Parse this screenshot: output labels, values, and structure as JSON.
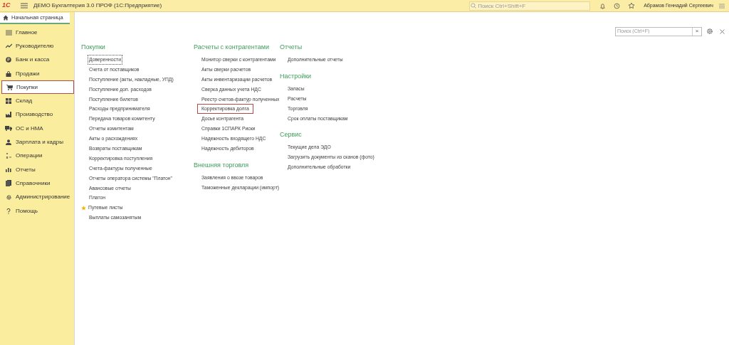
{
  "window": {
    "title": "ДЕМО Бухгалтерия 3.0 ПРОФ  (1С:Предприятие)",
    "logo": "1С",
    "search_placeholder": "Поиск Ctrl+Shift+F",
    "user": "Абрамов Геннадий Сергеевич"
  },
  "tabs": [
    {
      "label": "Начальная страница",
      "selected": true
    }
  ],
  "sidebar": {
    "items": [
      {
        "label": "Главное",
        "selected": false
      },
      {
        "label": "Руководителю",
        "selected": false
      },
      {
        "label": "Банк и касса",
        "selected": false
      },
      {
        "label": "Продажи",
        "selected": false
      },
      {
        "label": "Покупки",
        "selected": true
      },
      {
        "label": "Склад",
        "selected": false
      },
      {
        "label": "Производство",
        "selected": false
      },
      {
        "label": "ОС и НМА",
        "selected": false
      },
      {
        "label": "Зарплата и кадры",
        "selected": false
      },
      {
        "label": "Операции",
        "selected": false
      },
      {
        "label": "Отчеты",
        "selected": false
      },
      {
        "label": "Справочники",
        "selected": false
      },
      {
        "label": "Администрирование",
        "selected": false
      },
      {
        "label": "Помощь",
        "selected": false
      }
    ]
  },
  "panel": {
    "search_placeholder": "Поиск (Ctrl+F)",
    "clear": "×",
    "columns": [
      {
        "sections": [
          {
            "title": "Покупки",
            "items": [
              {
                "label": "Доверенности",
                "kind": "focused"
              },
              {
                "label": "Счета от поставщиков",
                "kind": "plain"
              },
              {
                "label": "Поступление (акты, накладные, УПД)",
                "kind": "plain"
              },
              {
                "label": "Поступление доп. расходов",
                "kind": "plain"
              },
              {
                "label": "Поступление билетов",
                "kind": "plain"
              },
              {
                "label": "Расходы предпринимателя",
                "kind": "plain"
              },
              {
                "label": "Передача товаров комитенту",
                "kind": "plain"
              },
              {
                "label": "Отчеты комитентам",
                "kind": "plain"
              },
              {
                "label": "Акты о расхождениях",
                "kind": "plain"
              },
              {
                "label": "Возвраты поставщикам",
                "kind": "plain"
              },
              {
                "label": "Корректировка поступления",
                "kind": "plain"
              },
              {
                "label": "Счета-фактуры полученные",
                "kind": "plain"
              },
              {
                "label": "Отчеты оператора системы \"Платон\"",
                "kind": "plain"
              },
              {
                "label": "Авансовые отчеты",
                "kind": "plain"
              },
              {
                "label": "Платон",
                "kind": "plain"
              },
              {
                "label": "Путевые листы",
                "kind": "starred"
              },
              {
                "label": "Выплаты самозанятым",
                "kind": "plain"
              }
            ]
          }
        ]
      },
      {
        "sections": [
          {
            "title": "Расчеты с контрагентами",
            "items": [
              {
                "label": "Монитор сверки с контрагентами",
                "kind": "plain"
              },
              {
                "label": "Акты сверки расчетов",
                "kind": "plain"
              },
              {
                "label": "Акты инвентаризации расчетов",
                "kind": "plain"
              },
              {
                "label": "Сверка данных учета НДС",
                "kind": "plain"
              },
              {
                "label": "Реестр счетов-фактур полученных",
                "kind": "plain"
              },
              {
                "label": "Корректировка долга",
                "kind": "boxed"
              },
              {
                "label": "Досье контрагента",
                "kind": "plain"
              },
              {
                "label": "Справки 1СПАРК Риски",
                "kind": "plain"
              },
              {
                "label": "Надежность входящего НДС",
                "kind": "plain"
              },
              {
                "label": "Надежность дебиторов",
                "kind": "plain"
              }
            ]
          },
          {
            "title": "Внешняя торговля",
            "items": [
              {
                "label": "Заявления о ввозе товаров",
                "kind": "plain"
              },
              {
                "label": "Таможенные декларации (импорт)",
                "kind": "plain"
              }
            ]
          }
        ]
      },
      {
        "sections": [
          {
            "title": "Отчеты",
            "items": [
              {
                "label": "Дополнительные отчеты",
                "kind": "plain"
              }
            ]
          },
          {
            "title": "Настройки",
            "items": [
              {
                "label": "Запасы",
                "kind": "plain"
              },
              {
                "label": "Расчеты",
                "kind": "plain"
              },
              {
                "label": "Торговля",
                "kind": "plain"
              },
              {
                "label": "Срок оплаты поставщикам",
                "kind": "plain"
              }
            ]
          },
          {
            "title": "Сервис",
            "items": [
              {
                "label": "Текущие дела ЭДО",
                "kind": "plain"
              },
              {
                "label": "Загрузить документы из сканов (фото)",
                "kind": "plain"
              },
              {
                "label": "Дополнительные обработки",
                "kind": "plain"
              }
            ]
          }
        ]
      }
    ]
  }
}
